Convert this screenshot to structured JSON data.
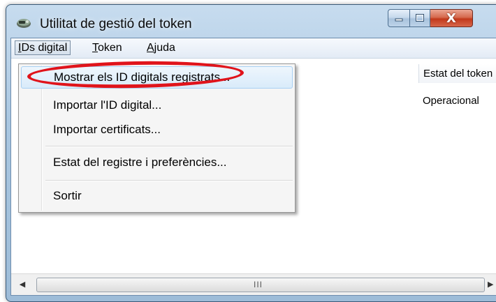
{
  "window": {
    "title": "Utilitat de gestió del token",
    "icon": "token-app-icon",
    "controls": [
      "minimize-icon",
      "maximize-icon",
      "close-icon"
    ],
    "close_glyph": "X"
  },
  "menubar": {
    "items": [
      {
        "label_pre": "",
        "mnemonic": "I",
        "label_post": "Ds digital",
        "active": true
      },
      {
        "label_pre": "",
        "mnemonic": "T",
        "label_post": "oken",
        "active": false
      },
      {
        "label_pre": "",
        "mnemonic": "A",
        "label_post": "juda",
        "active": false
      }
    ]
  },
  "table": {
    "column_header": "Estat del token",
    "rows": [
      {
        "status": "Operacional"
      }
    ]
  },
  "scrollbar": {
    "grip": "III"
  },
  "dropdown": {
    "items": [
      {
        "label": "Mostrar els ID digitals registrats...",
        "highlighted": true
      },
      {
        "label": "Importar l'ID digital..."
      },
      {
        "label": "Importar certificats..."
      },
      {
        "label": "Estat del registre i preferències..."
      },
      {
        "label": "Sortir"
      }
    ]
  },
  "annotation": {
    "color": "#e0141b"
  }
}
